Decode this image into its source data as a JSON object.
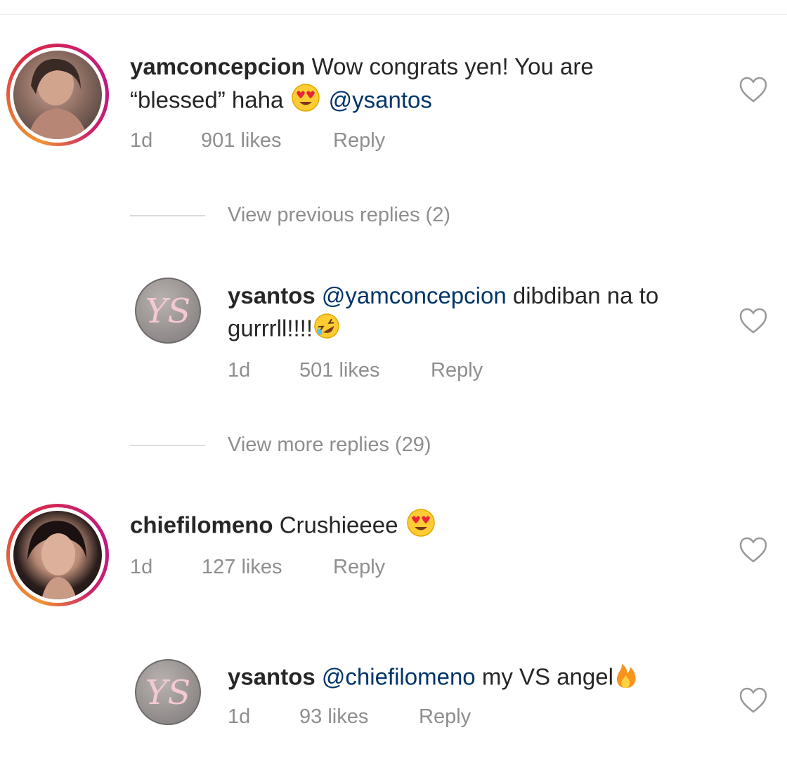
{
  "comments": [
    {
      "username": "yamconcepcion",
      "text_line1": "Wow congrats yen! You are",
      "text_line2": "“blessed” haha",
      "mention": "@ysantos",
      "time": "1d",
      "likes": "901 likes",
      "reply": "Reply"
    },
    {
      "username": "chiefilomeno",
      "text": "Crushieeee",
      "time": "1d",
      "likes": "127 likes",
      "reply": "Reply"
    }
  ],
  "replies": [
    {
      "username": "ysantos",
      "mention": "@yamconcepcion",
      "text_line1_rest": "dibdiban na to",
      "text_line2": "gurrrll!!!!",
      "time": "1d",
      "likes": "501 likes",
      "reply": "Reply"
    },
    {
      "username": "ysantos",
      "mention": "@chiefilomeno",
      "text": "my VS angel",
      "time": "1d",
      "likes": "93 likes",
      "reply": "Reply"
    }
  ],
  "view_links": {
    "previous": "View previous replies (2)",
    "more": "View more replies (29)"
  },
  "avatar_initials": "YS",
  "icons": {
    "like": "heart-outline-icon",
    "heart_eyes": "heart-eyes-emoji",
    "rofl": "rolling-laughing-emoji",
    "fire": "fire-emoji"
  },
  "colors": {
    "mention": "#003569",
    "meta": "#8e8e8e",
    "text": "#262626"
  }
}
